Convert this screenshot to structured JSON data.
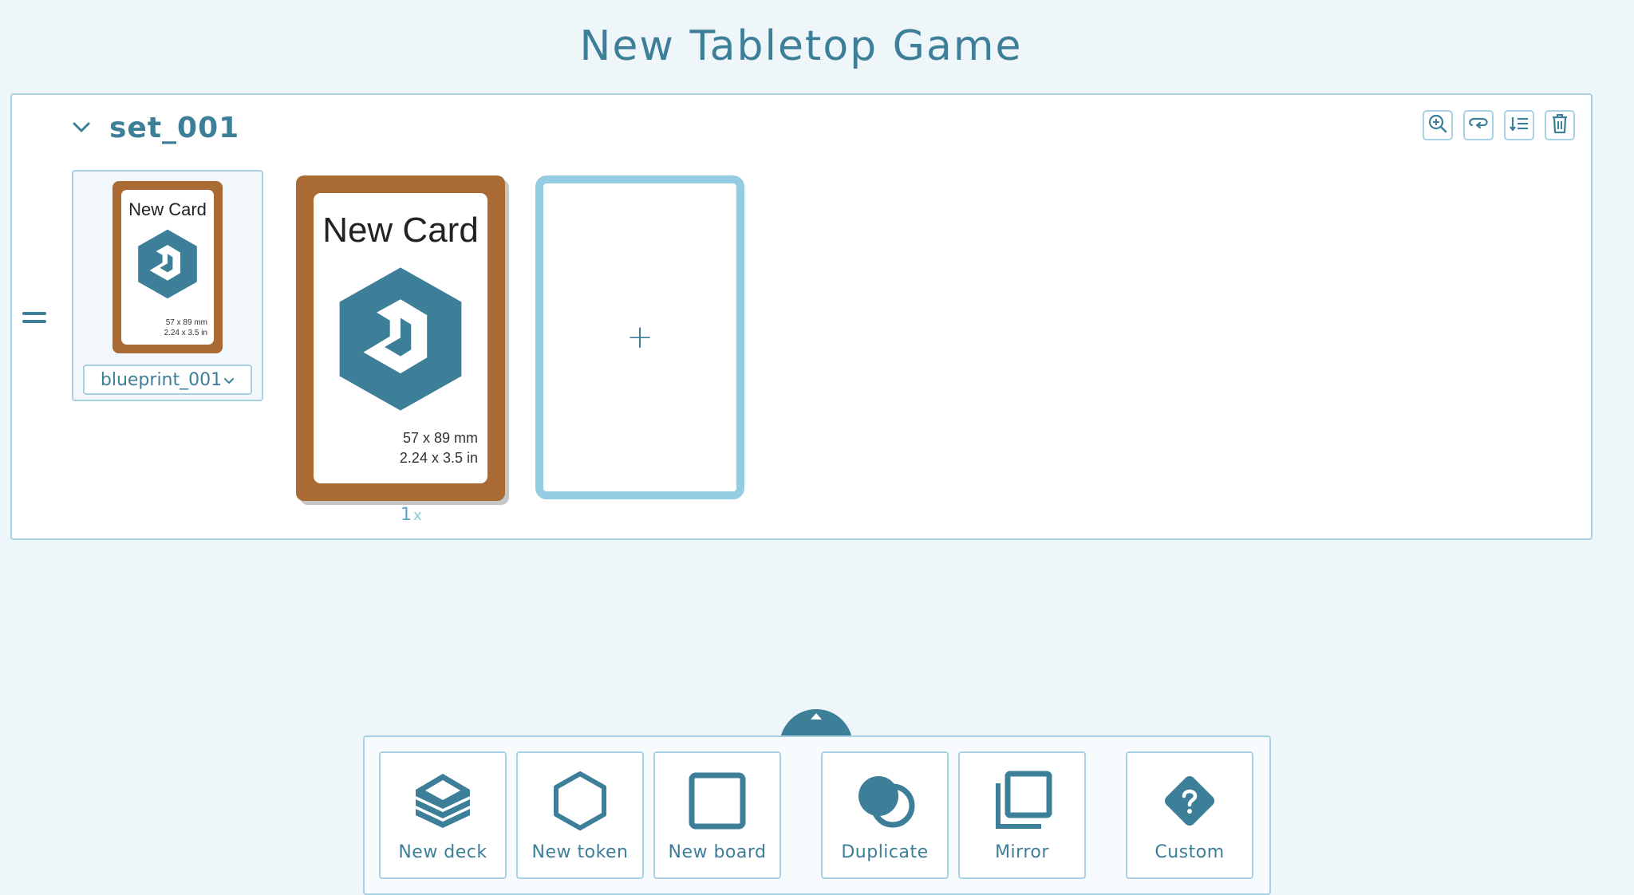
{
  "page": {
    "title": "New Tabletop Game"
  },
  "set": {
    "name": "set_001",
    "tools": [
      {
        "icon": "zoom-in-icon"
      },
      {
        "icon": "flip-icon"
      },
      {
        "icon": "sort-icon"
      },
      {
        "icon": "trash-icon"
      }
    ],
    "blueprint": {
      "selected": "blueprint_001",
      "card_title": "New Card",
      "dims_mm": "57 x 89 mm",
      "dims_in": "2.24 x 3.5 in"
    },
    "cards": [
      {
        "title": "New Card",
        "dims_mm": "57 x 89 mm",
        "dims_in": "2.24 x 3.5 in",
        "count": "1",
        "count_suffix": "x"
      }
    ],
    "add_label": "+"
  },
  "tray": {
    "buttons": [
      {
        "label": "New deck",
        "icon": "deck-icon"
      },
      {
        "label": "New token",
        "icon": "hexagon-icon"
      },
      {
        "label": "New board",
        "icon": "square-icon"
      },
      {
        "label": "Duplicate",
        "icon": "duplicate-icon"
      },
      {
        "label": "Mirror",
        "icon": "mirror-icon"
      },
      {
        "label": "Custom",
        "icon": "help-diamond-icon"
      }
    ]
  },
  "colors": {
    "accent": "#3d7f99",
    "card_border": "#a96a34",
    "light_border": "#a8d2e4",
    "background": "#eff6fa"
  }
}
